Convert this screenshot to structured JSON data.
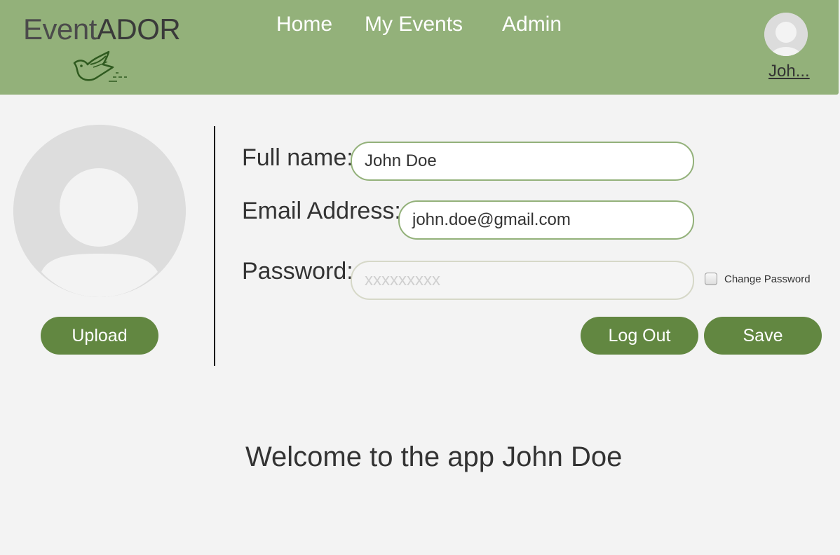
{
  "app": {
    "logo_prefix": "Event",
    "logo_suffix": "ADOR"
  },
  "nav": {
    "home": "Home",
    "my_events": "My Events",
    "admin": "Admin"
  },
  "user": {
    "short_name": "Joh..."
  },
  "profile": {
    "upload_label": "Upload",
    "full_name_label": "Full name:",
    "full_name_value": "John Doe",
    "email_label": "Email Address:",
    "email_value": "john.doe@gmail.com",
    "password_label": "Password:",
    "password_value": "xxxxxxxxx",
    "change_password_label": "Change Password",
    "change_password_checked": false,
    "logout_label": "Log Out",
    "save_label": "Save"
  },
  "welcome_text": "Welcome to the app John Doe",
  "colors": {
    "header_bg": "#93b17a",
    "button_bg": "#628741",
    "field_border": "#93b17a",
    "page_bg": "#f3f3f3"
  }
}
